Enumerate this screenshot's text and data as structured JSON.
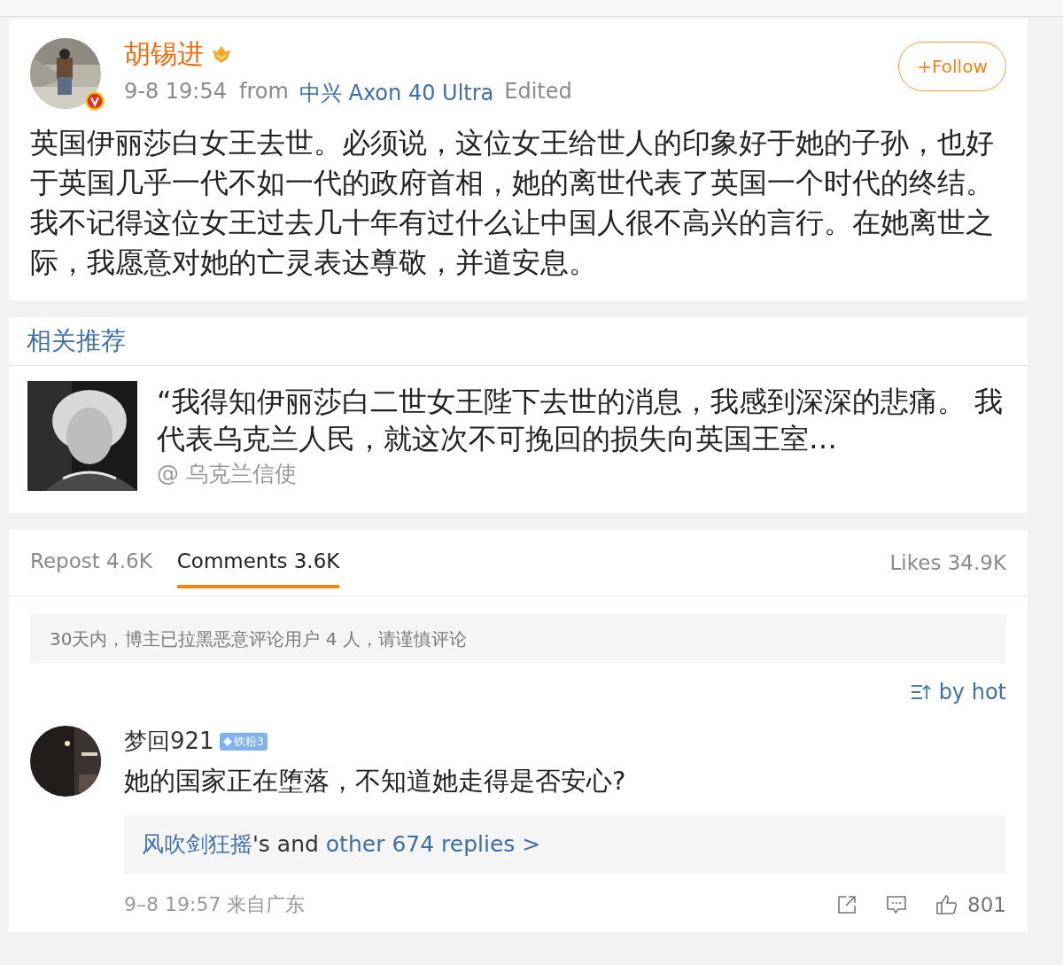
{
  "post": {
    "author": "胡锡进",
    "time": "9-8 19:54",
    "from_label": "from",
    "device": "中兴 Axon 40 Ultra",
    "edited": "Edited",
    "follow": "+Follow",
    "text": "英国伊丽莎白女王去世。必须说，这位女王给世人的印象好于她的子孙，也好于英国几乎一代不如一代的政府首相，她的离世代表了英国一个时代的终结。我不记得这位女王过去几十年有过什么让中国人很不高兴的言行。在她离世之际，我愿意对她的亡灵表达尊敬，并道安息。"
  },
  "related": {
    "title": "相关推荐",
    "item": {
      "text": "“我得知伊丽莎白二世女王陛下去世的消息，我感到深深的悲痛。 我代表乌克兰人民，就这次不可挽回的损失向英国王室…",
      "source": "@ 乌克兰信使"
    }
  },
  "tabs": [
    {
      "label": "Repost 4.6K",
      "selected": false
    },
    {
      "label": "Comments 3.6K",
      "selected": true
    }
  ],
  "likes": "Likes 34.9K",
  "notice": "30天内，博主已拉黑恶意评论用户 4 人，请谨慎评论",
  "sort": "by hot",
  "comments": [
    {
      "user": "梦回921",
      "badge": "铁粉3",
      "text": "她的国家正在堕落，不知道她走得是否安心?",
      "reply_user": "风吹剑狂摇",
      "reply_mid": "'s and ",
      "reply_more": "other 674 replies >",
      "time": "9–8 19:57 来自广东",
      "like_count": "801"
    }
  ]
}
